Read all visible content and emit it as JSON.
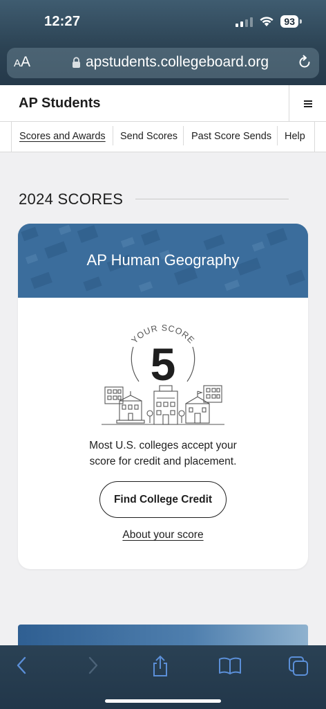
{
  "status_bar": {
    "time": "12:27",
    "battery": "93"
  },
  "browser": {
    "text_size_small": "A",
    "text_size_large": "A",
    "url": "apstudents.collegeboard.org"
  },
  "site": {
    "title": "AP Students",
    "nav": [
      {
        "label": "Scores and Awards",
        "active": true
      },
      {
        "label": "Send Scores",
        "active": false
      },
      {
        "label": "Past Score Sends",
        "active": false
      },
      {
        "label": "Help",
        "active": false
      }
    ]
  },
  "scores": {
    "heading": "2024 SCORES",
    "card": {
      "course": "AP Human Geography",
      "score_label": "YOUR SCORE",
      "score": "5",
      "message_line1": "Most U.S. colleges accept your",
      "message_line2": "score for credit and placement.",
      "cta": "Find College Credit",
      "link": "About your score"
    }
  },
  "colors": {
    "banner": "#3c6f9e",
    "browser_chrome": "#2c4354",
    "page_bg": "#f0f0f2",
    "toolbar_icon": "#5b8fd8"
  },
  "icons": [
    "lock-icon",
    "reload-icon",
    "hamburger-menu-icon",
    "back-icon",
    "forward-icon",
    "share-icon",
    "bookmarks-icon",
    "tabs-icon",
    "wifi-icon",
    "signal-icon",
    "buildings-illustration"
  ]
}
